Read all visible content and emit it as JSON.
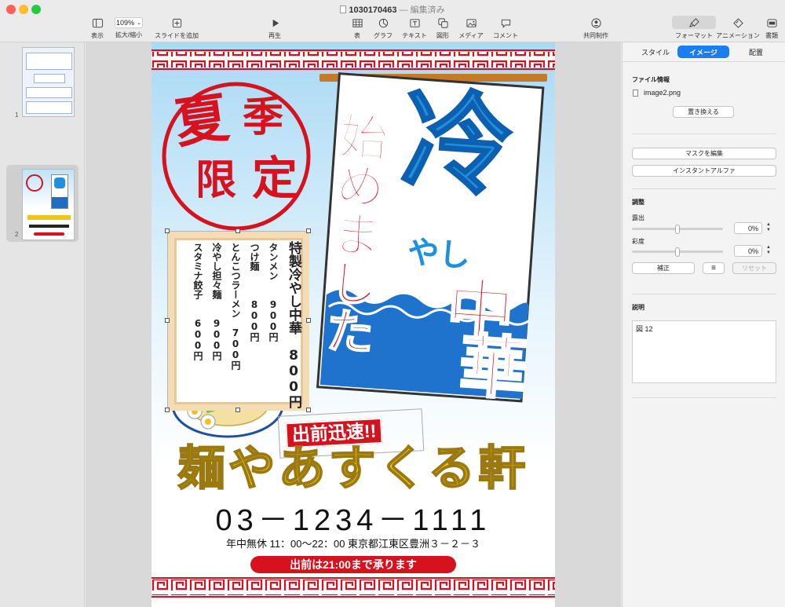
{
  "window": {
    "file_name": "1030170463",
    "separator": "—",
    "status": "編集済み"
  },
  "toolbar": {
    "view_label": "表示",
    "zoom_value": "109%",
    "zoom_label": "拡大/縮小",
    "add_slide_label": "スライドを追加",
    "play_label": "再生",
    "table_label": "表",
    "chart_label": "グラフ",
    "text_label": "テキスト",
    "shape_label": "図形",
    "media_label": "メディア",
    "comment_label": "コメント",
    "collab_label": "共同制作",
    "format_label": "フォーマット",
    "animate_label": "アニメーション",
    "document_label": "書類"
  },
  "navigator": {
    "slides": [
      {
        "number": "1"
      },
      {
        "number": "2"
      }
    ]
  },
  "slide": {
    "badge_chars": [
      "夏",
      "季",
      "限",
      "定"
    ],
    "banner_main": "冷",
    "banner_yashi": "やし",
    "banner_chuka": [
      "中",
      "華"
    ],
    "banner_side": "始めました",
    "menu_items": [
      {
        "name": "特製冷やし中華",
        "price": "800円"
      },
      {
        "name": "タンメン",
        "price": "900円"
      },
      {
        "name": "つけ麺",
        "price": "800円"
      },
      {
        "name": "とんこつラーメン",
        "price": "700円"
      },
      {
        "name": "冷やし担々麺",
        "price": "900円"
      },
      {
        "name": "スタミナ餃子",
        "price": "600円"
      }
    ],
    "delivery_stamp": "出前迅速!!",
    "shop_name": "麺やあすくる軒",
    "phone": "03－1234－1111",
    "info_line": "年中無休 11：00～22：00 東京都江東区豊洲３－２－３",
    "delivery_note": "出前は21:00まで承ります"
  },
  "inspector": {
    "tabs": [
      "スタイル",
      "イメージ",
      "配置"
    ],
    "active_tab": "イメージ",
    "file_info_title": "ファイル情報",
    "file_name": "image2.png",
    "replace_button": "置き換える",
    "edit_mask_button": "マスクを編集",
    "instant_alpha_button": "インスタントアルファ",
    "adjust_title": "調整",
    "exposure_label": "露出",
    "exposure_value": "0%",
    "exposure_level": 0.5,
    "saturation_label": "彩度",
    "saturation_value": "0%",
    "saturation_level": 0.5,
    "enhance_button": "補正",
    "reset_button": "リセット",
    "description_title": "説明",
    "description_text": "図 12"
  },
  "colors": {
    "accent": "#1a73e8",
    "poster_red": "#d7121f",
    "poster_blue": "#1f8fe0",
    "poster_yellow": "#f2c21a",
    "tab_active": "#1a7df0"
  }
}
